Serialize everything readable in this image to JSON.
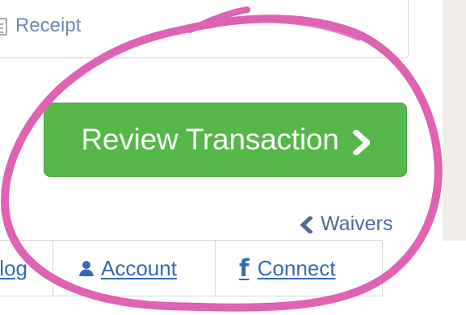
{
  "receipt": {
    "label": "Receipt",
    "icon": "receipt-icon"
  },
  "review_button": {
    "label": "Review Transaction",
    "icon": "chevron-right-icon",
    "color": "#55b849"
  },
  "waivers_link": {
    "label": "Waivers",
    "icon": "chevron-left-icon"
  },
  "nav_tabs": [
    {
      "label": "log",
      "icon": ""
    },
    {
      "label": "Account",
      "icon": "person-icon"
    },
    {
      "label": "Connect",
      "icon": "facebook-icon"
    }
  ],
  "annotation": {
    "color": "#df62b3"
  },
  "theme": {
    "link_blue": "#3569b7",
    "muted_blue": "#6a8ab8",
    "panel_gray": "#efebe7",
    "border_gray": "#d8d8d8"
  }
}
